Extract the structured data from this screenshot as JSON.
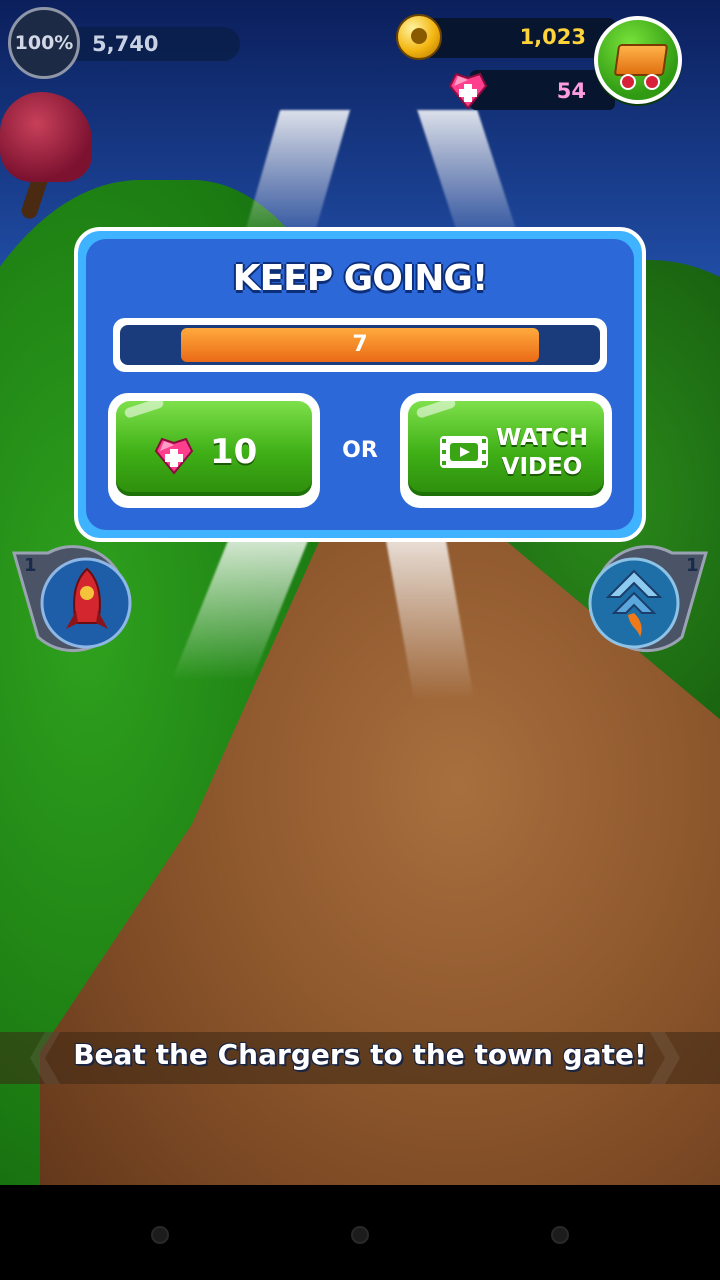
{
  "hud": {
    "progress_percent": "100%",
    "score": "5,740",
    "coins": "1,023",
    "gems": "54"
  },
  "dialog": {
    "title": "KEEP GOING!",
    "timer_value": "7",
    "timer_fraction": 0.74,
    "gem_cost": "10",
    "or_label": "OR",
    "video_line1": "WATCH",
    "video_line2": "VIDEO"
  },
  "powerups": {
    "rocket_count": "1",
    "boost_count": "1"
  },
  "objective": "Beat the Chargers to the town gate!",
  "colors": {
    "dialog_bg": "#2d68d9",
    "button_green": "#3faf16",
    "timer_orange": "#ea6a16",
    "coin_gold": "#ffd33a",
    "gem_pink": "#ff9ce0"
  },
  "icons": [
    "coin-icon",
    "gem-icon",
    "shop-cart-icon",
    "video-film-icon",
    "rocket-icon",
    "boost-arrow-icon"
  ]
}
